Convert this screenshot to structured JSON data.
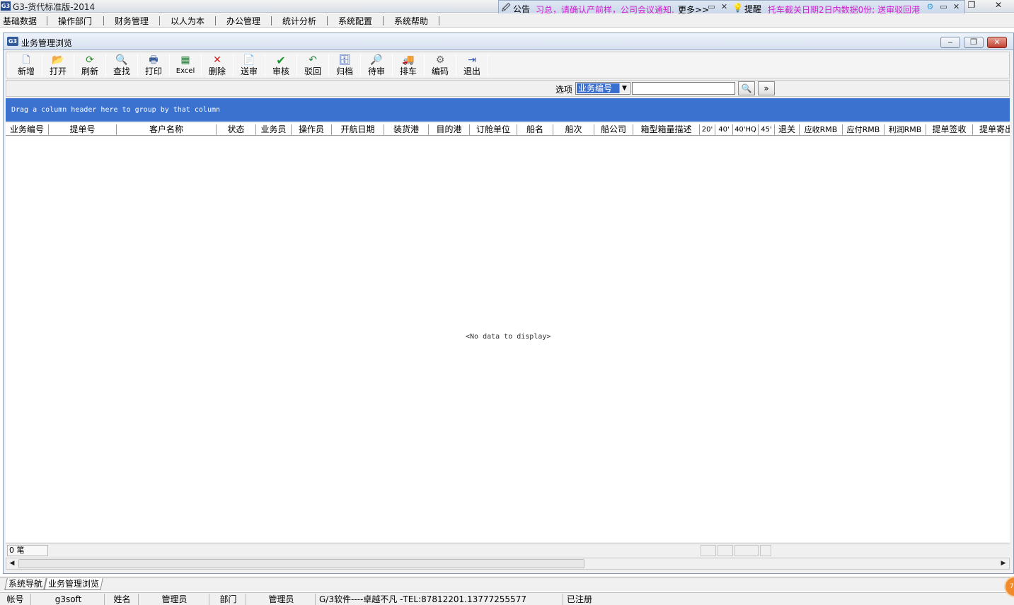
{
  "app": {
    "logo_text": "G3",
    "title": "G3-货代标准版-2014"
  },
  "notice_bar": {
    "announcement_label": "公告",
    "announcement_text": "习总，请确认产前样，公司会议通知.",
    "more_label": "更多>>",
    "reminder_label": "提醒",
    "reminder_text": "托车截关日期2日内数据0份; 送审驳回港"
  },
  "menu": [
    "基础数据",
    "操作部门",
    "财务管理",
    "以人为本",
    "办公管理",
    "统计分析",
    "系统配置",
    "系统帮助"
  ],
  "child_window": {
    "logo_text": "G3",
    "title": "业务管理浏览"
  },
  "toolbar": [
    {
      "label": "新增",
      "icon": "new-document-icon",
      "glyph": "🗋"
    },
    {
      "label": "打开",
      "icon": "open-folder-icon",
      "glyph": "📂"
    },
    {
      "label": "刷新",
      "icon": "refresh-icon",
      "glyph": "⟳"
    },
    {
      "label": "查找",
      "icon": "search-icon",
      "glyph": "🔍"
    },
    {
      "label": "打印",
      "icon": "print-preview-icon",
      "glyph": "🖶"
    },
    {
      "label": "Excel",
      "icon": "excel-icon",
      "glyph": "▦"
    },
    {
      "label": "删除",
      "icon": "delete-icon",
      "glyph": "✕"
    },
    {
      "label": "送审",
      "icon": "submit-icon",
      "glyph": "📄"
    },
    {
      "label": "审核",
      "icon": "approve-check-icon",
      "glyph": "✔"
    },
    {
      "label": "驳回",
      "icon": "reject-undo-icon",
      "glyph": "↶"
    },
    {
      "label": "归档",
      "icon": "archive-icon",
      "glyph": "🗄"
    },
    {
      "label": "待审",
      "icon": "pending-icon",
      "glyph": "🔎"
    },
    {
      "label": "排车",
      "icon": "truck-icon",
      "glyph": "🚚"
    },
    {
      "label": "编码",
      "icon": "gears-icon",
      "glyph": "⚙"
    },
    {
      "label": "退出",
      "icon": "exit-door-icon",
      "glyph": "⇥"
    }
  ],
  "options": {
    "label": "选项",
    "selected": "业务编号",
    "search_value": "",
    "search_button": "🔍",
    "expand_button": "»"
  },
  "group_panel": {
    "text": "Drag a column header here to group by that column"
  },
  "columns": [
    "业务编号",
    "提单号",
    "客户名称",
    "状态",
    "业务员",
    "操作员",
    "开航日期",
    "装货港",
    "目的港",
    "订舱单位",
    "船名",
    "船次",
    "船公司",
    "箱型箱量描述",
    "20'",
    "40'",
    "40'HQ",
    "45'",
    "退关",
    "应收RMB",
    "应付RMB",
    "利润RMB",
    "提单签收",
    "提单寄出"
  ],
  "grid": {
    "empty_text": "<No data to display>"
  },
  "footer": {
    "count_text": "0 笔"
  },
  "tabs": [
    "系统导航",
    "业务管理浏览"
  ],
  "status": {
    "account_label": "帐号",
    "account_value": "g3soft",
    "name_label": "姓名",
    "name_value": "管理员",
    "dept_label": "部门",
    "dept_value": "管理员",
    "company_text": "G/3软件----卓越不凡 -TEL:87812201.13777255577",
    "registration": "已注册"
  },
  "colors": {
    "accent_blue": "#3b71cf",
    "notice_magenta": "#d020d0",
    "close_red": "#c2412f"
  }
}
